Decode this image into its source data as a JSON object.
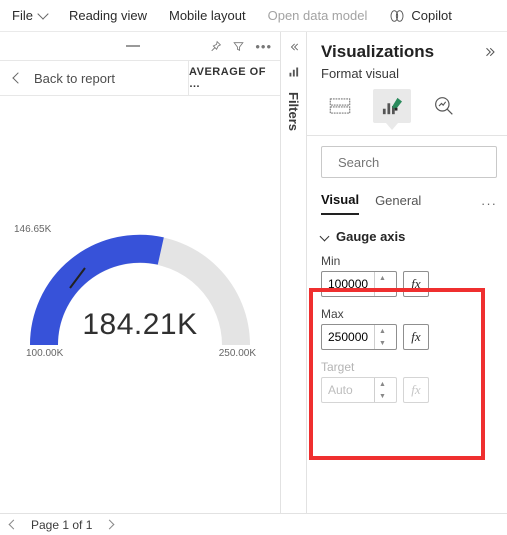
{
  "topbar": {
    "file": "File",
    "reading_view": "Reading view",
    "mobile_layout": "Mobile layout",
    "open_data_model": "Open data model",
    "copilot": "Copilot"
  },
  "canvas": {
    "back_label": "Back to report",
    "header_title": "AVERAGE OF …"
  },
  "chart_data": {
    "type": "gauge",
    "value_label": "184.21K",
    "min_label": "100.00K",
    "max_label": "250.00K",
    "target_label": "146.65K",
    "value": 184210,
    "min": 100000,
    "max": 250000,
    "target": 146650,
    "fill_color": "#3752d9",
    "track_color": "#e4e4e4"
  },
  "filters_rail": {
    "label": "Filters"
  },
  "pane": {
    "title": "Visualizations",
    "subtitle": "Format visual",
    "search_placeholder": "Search",
    "subtabs": {
      "visual": "Visual",
      "general": "General"
    },
    "gauge_axis": {
      "title": "Gauge axis",
      "min_label": "Min",
      "min_value": "100000",
      "max_label": "Max",
      "max_value": "250000",
      "target_label": "Target",
      "target_value": "Auto",
      "fx_label": "fx"
    }
  },
  "footer": {
    "page_label": "Page 1 of 1"
  }
}
